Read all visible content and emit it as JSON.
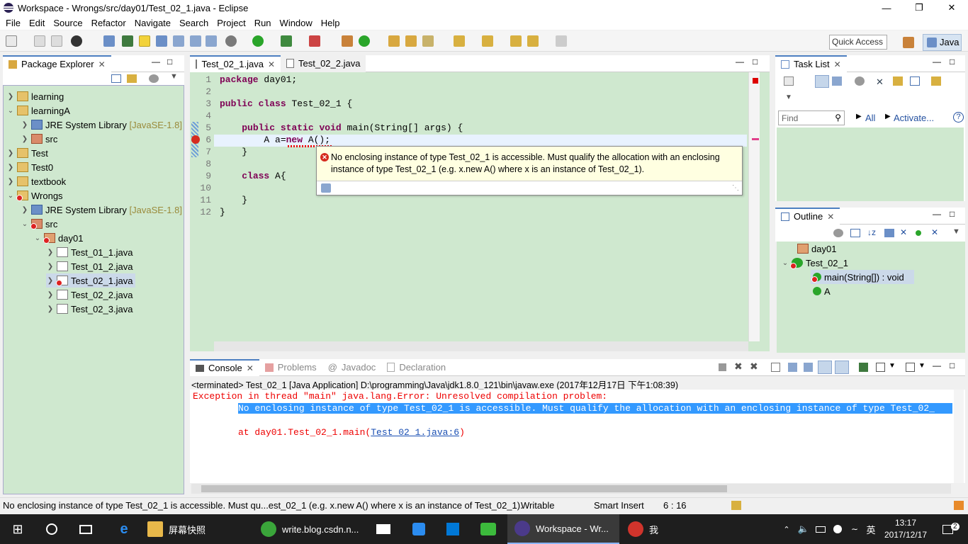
{
  "window": {
    "title": "Workspace - Wrongs/src/day01/Test_02_1.java - Eclipse"
  },
  "menu": [
    "File",
    "Edit",
    "Source",
    "Refactor",
    "Navigate",
    "Search",
    "Project",
    "Run",
    "Window",
    "Help"
  ],
  "toolbar": {
    "quick_access": "Quick Access",
    "perspective": "Java"
  },
  "package_explorer": {
    "title": "Package Explorer",
    "items": [
      {
        "label": "learning",
        "extra": ""
      },
      {
        "label": "learningA",
        "extra": ""
      },
      {
        "label": "JRE System Library",
        "extra": "[JavaSE-1.8]"
      },
      {
        "label": "src",
        "extra": ""
      },
      {
        "label": "Test",
        "extra": ""
      },
      {
        "label": "Test0",
        "extra": ""
      },
      {
        "label": "textbook",
        "extra": ""
      },
      {
        "label": "Wrongs",
        "extra": ""
      },
      {
        "label": "JRE System Library",
        "extra": "[JavaSE-1.8]"
      },
      {
        "label": "src",
        "extra": ""
      },
      {
        "label": "day01",
        "extra": ""
      },
      {
        "label": "Test_01_1.java",
        "extra": ""
      },
      {
        "label": "Test_01_2.java",
        "extra": ""
      },
      {
        "label": "Test_02_1.java",
        "extra": ""
      },
      {
        "label": "Test_02_2.java",
        "extra": ""
      },
      {
        "label": "Test_02_3.java",
        "extra": ""
      }
    ]
  },
  "editor": {
    "tabs": [
      {
        "label": "Test_02_1.java"
      },
      {
        "label": "Test_02_2.java"
      }
    ],
    "lines": [
      {
        "no": "1",
        "text": "package day01;"
      },
      {
        "no": "2",
        "text": ""
      },
      {
        "no": "3",
        "text": "public class Test_02_1 {"
      },
      {
        "no": "4",
        "text": ""
      },
      {
        "no": "5",
        "text": "    public static void main(String[] args) {"
      },
      {
        "no": "6",
        "text": "        A a=new A();"
      },
      {
        "no": "7",
        "text": "    }"
      },
      {
        "no": "8",
        "text": ""
      },
      {
        "no": "9",
        "text": "    class A{"
      },
      {
        "no": "10",
        "text": ""
      },
      {
        "no": "11",
        "text": "    }"
      },
      {
        "no": "12",
        "text": "}"
      }
    ],
    "tooltip": "No enclosing instance of type Test_02_1 is accessible. Must qualify the allocation with an enclosing instance of type Test_02_1 (e.g. x.new A() where x is an instance of Test_02_1)."
  },
  "task_list": {
    "title": "Task List",
    "find_placeholder": "Find",
    "all_label": "All",
    "activate_label": "Activate..."
  },
  "outline": {
    "title": "Outline",
    "items": [
      {
        "label": "day01"
      },
      {
        "label": "Test_02_1"
      },
      {
        "label": "main(String[]) : void"
      },
      {
        "label": "A"
      }
    ]
  },
  "console": {
    "tabs": [
      "Console",
      "Problems",
      "Javadoc",
      "Declaration"
    ],
    "header": "<terminated> Test_02_1 [Java Application] D:\\programming\\Java\\jdk1.8.0_121\\bin\\javaw.exe (2017年12月17日 下午1:08:39)",
    "line1": "Exception in thread \"main\" java.lang.Error: Unresolved compilation problem: ",
    "line2": "No enclosing instance of type Test_02_1 is accessible. Must qualify the allocation with an enclosing instance of type Test_02_",
    "line3_prefix": "at day01.Test_02_1.main(",
    "line3_link": "Test_02_1.java:6",
    "line3_suffix": ")"
  },
  "status": {
    "message": "No enclosing instance of type Test_02_1 is accessible. Must qu...est_02_1 (e.g. x.new A() where x is an instance of Test_02_1).",
    "writable": "Writable",
    "insert_mode": "Smart Insert",
    "position": "6 : 16"
  },
  "taskbar": {
    "apps": [
      {
        "label": "屏幕快照"
      },
      {
        "label": "write.blog.csdn.n..."
      },
      {
        "label": "Workspace - Wr..."
      },
      {
        "label": "我"
      }
    ],
    "ime": "英",
    "time": "13:17",
    "date": "2017/12/17",
    "notification_count": "2"
  }
}
